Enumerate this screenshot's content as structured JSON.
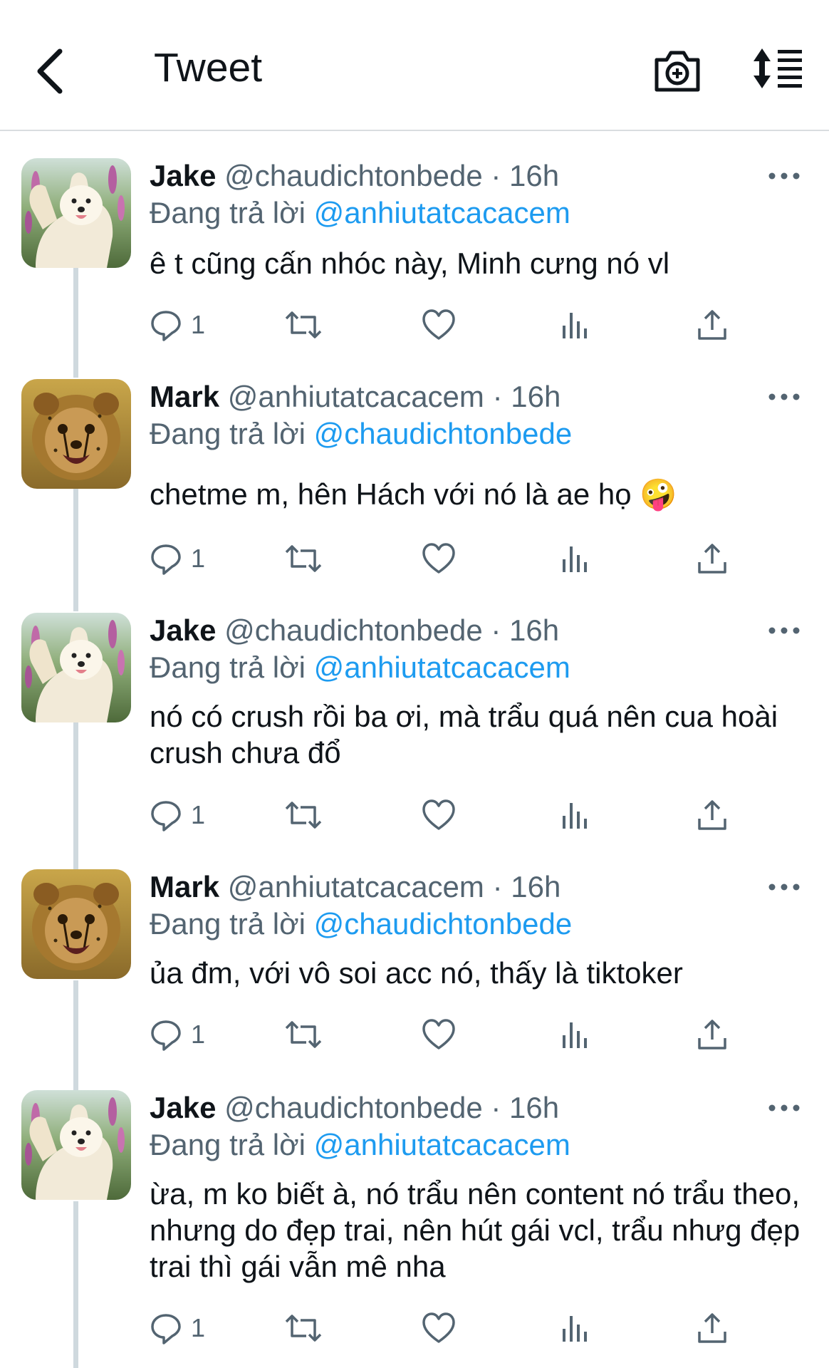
{
  "header": {
    "title": "Tweet",
    "back_icon": "chevron-left-icon",
    "camera_icon": "camera-plus-icon",
    "sort_icon": "sort-list-icon"
  },
  "colors": {
    "accent": "#1d9bf0",
    "secondary_text": "#536471",
    "primary_text": "#0f1419",
    "thread_line": "#cfd9de"
  },
  "tweets": [
    {
      "name": "Jake",
      "handle": "@chaudichtonbede",
      "time": "· 16h",
      "reply_prefix": "Đang trả lời",
      "reply_to": "@anhiutatcacacem",
      "text": "ê t cũng cấn nhóc này, Minh cưng nó vl",
      "reply_count": "1",
      "avatar": "samoyed-dog"
    },
    {
      "name": "Mark",
      "handle": "@anhiutatcacacem",
      "time": "· 16h",
      "reply_prefix": "Đang trả lời",
      "reply_to": "@chaudichtonbede",
      "text": "chetme m, hên Hách với nó là ae họ 🤪",
      "reply_count": "1",
      "avatar": "cheetah-cub"
    },
    {
      "name": "Jake",
      "handle": "@chaudichtonbede",
      "time": "· 16h",
      "reply_prefix": "Đang trả lời",
      "reply_to": "@anhiutatcacacem",
      "text": "nó có crush rồi ba ơi, mà trẩu quá nên cua hoài crush chưa đổ",
      "reply_count": "1",
      "avatar": "samoyed-dog"
    },
    {
      "name": "Mark",
      "handle": "@anhiutatcacacem",
      "time": "· 16h",
      "reply_prefix": "Đang trả lời",
      "reply_to": "@chaudichtonbede",
      "text": "ủa đm, với vô soi acc nó, thấy là tiktoker",
      "reply_count": "1",
      "avatar": "cheetah-cub"
    },
    {
      "name": "Jake",
      "handle": "@chaudichtonbede",
      "time": "· 16h",
      "reply_prefix": "Đang trả lời",
      "reply_to": "@anhiutatcacacem",
      "text": "ừa, m ko biết à, nó trẩu nên content nó trẩu theo, nhưng do đẹp trai, nên hút gái vcl, trẩu nhưg đẹp trai thì gái vẫn mê nha",
      "reply_count": "1",
      "avatar": "samoyed-dog"
    }
  ]
}
